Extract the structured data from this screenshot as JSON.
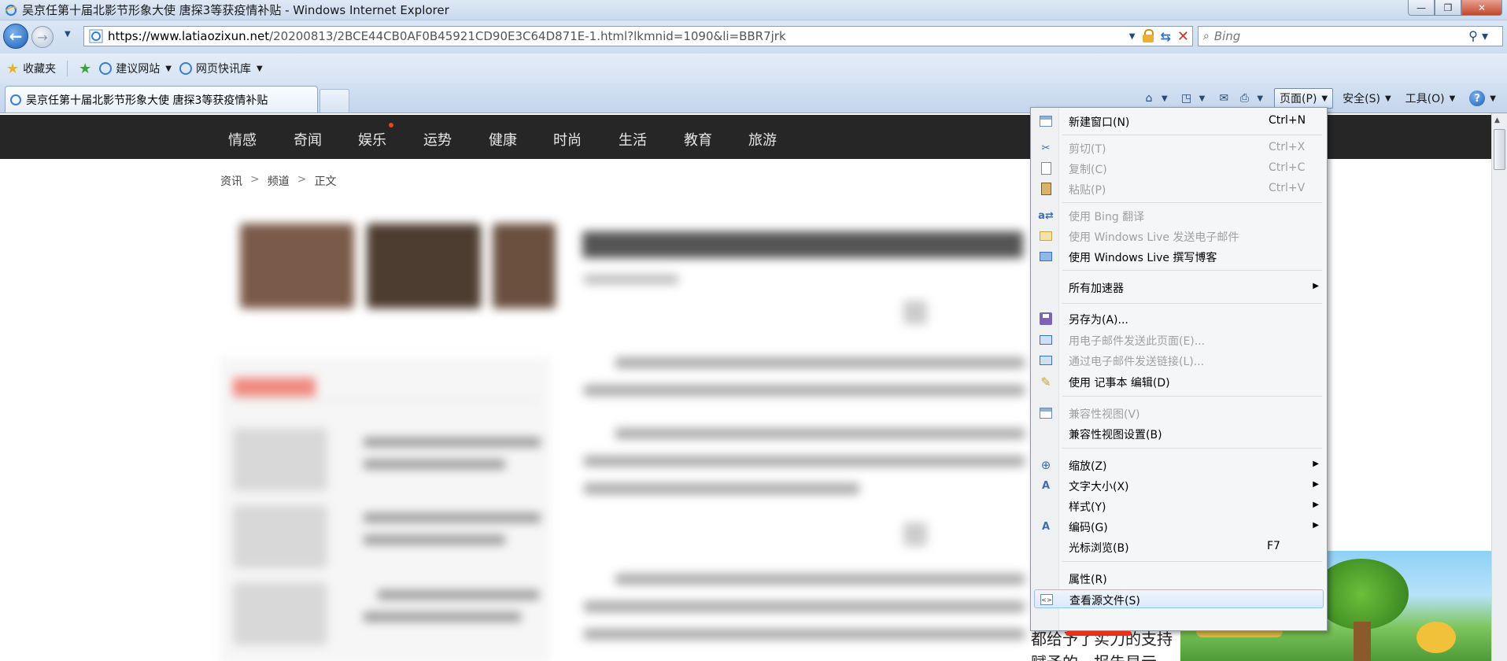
{
  "window": {
    "title": "吴京任第十届北影节形象大使 唐探3等获疫情补贴 - Windows Internet Explorer",
    "min_label": "—",
    "max_label": "❐",
    "close_label": "✕"
  },
  "address": {
    "url_scheme": "https://",
    "url_host": "www.latiaozixun.net",
    "url_rest": "/20200813/2BCE44CB0AF0B45921CD90E3C64D871E-1.html?lkmnid=1090&li=BBR7jrk",
    "search_placeholder": "Bing"
  },
  "favorites": {
    "label": "收藏夹",
    "items": [
      {
        "label": "建议网站"
      },
      {
        "label": "网页快讯库"
      }
    ]
  },
  "tab": {
    "label": "吴京任第十届北影节形象大使 唐探3等获疫情补贴"
  },
  "command_bar": {
    "page": "页面(P)",
    "safety": "安全(S)",
    "tools": "工具(O)",
    "help": "?"
  },
  "site": {
    "nav": [
      "情感",
      "奇闻",
      "娱乐",
      "运势",
      "健康",
      "时尚",
      "生活",
      "教育",
      "旅游"
    ],
    "breadcrumb": [
      "资讯",
      "频道",
      "正文"
    ],
    "breadcrumb_sep": ">",
    "article_fragment_1": "都给予了实力的支持",
    "article_fragment_2": "赋予的，报告显示"
  },
  "page_menu": {
    "items": [
      {
        "label": "新建窗口(N)",
        "shortcut": "Ctrl+N",
        "icon": "new-window-icon",
        "disabled": false
      },
      {
        "label": "剪切(T)",
        "shortcut": "Ctrl+X",
        "icon": "cut-icon",
        "disabled": true
      },
      {
        "label": "复制(C)",
        "shortcut": "Ctrl+C",
        "icon": "copy-icon",
        "disabled": true
      },
      {
        "label": "粘贴(P)",
        "shortcut": "Ctrl+V",
        "icon": "paste-icon",
        "disabled": false
      },
      {
        "label": "使用 Bing 翻译",
        "shortcut": "",
        "icon": "translate-icon",
        "disabled": true
      },
      {
        "label": "使用 Windows Live 发送电子邮件",
        "shortcut": "",
        "icon": "live-mail-icon",
        "disabled": true
      },
      {
        "label": "使用 Windows Live 撰写博客",
        "shortcut": "",
        "icon": "live-blog-icon",
        "disabled": false
      },
      {
        "label": "所有加速器",
        "shortcut": "",
        "icon": "",
        "disabled": false,
        "submenu": true
      },
      {
        "label": "另存为(A)...",
        "shortcut": "",
        "icon": "save-as-icon",
        "disabled": false
      },
      {
        "label": "用电子邮件发送此页面(E)...",
        "shortcut": "",
        "icon": "email-page-icon",
        "disabled": true
      },
      {
        "label": "通过电子邮件发送链接(L)...",
        "shortcut": "",
        "icon": "email-link-icon",
        "disabled": true
      },
      {
        "label": "使用 记事本 编辑(D)",
        "shortcut": "",
        "icon": "edit-pencil-icon",
        "disabled": false
      },
      {
        "label": "兼容性视图(V)",
        "shortcut": "",
        "icon": "compat-view-icon",
        "disabled": true
      },
      {
        "label": "兼容性视图设置(B)",
        "shortcut": "",
        "icon": "",
        "disabled": false
      },
      {
        "label": "缩放(Z)",
        "shortcut": "",
        "icon": "zoom-icon",
        "disabled": false,
        "submenu": true
      },
      {
        "label": "文字大小(X)",
        "shortcut": "",
        "icon": "text-size-icon",
        "disabled": false,
        "submenu": true
      },
      {
        "label": "样式(Y)",
        "shortcut": "",
        "icon": "",
        "disabled": false,
        "submenu": true
      },
      {
        "label": "编码(G)",
        "shortcut": "",
        "icon": "encoding-icon",
        "disabled": false,
        "submenu": true
      },
      {
        "label": "光标浏览(B)",
        "shortcut": "F7",
        "icon": "",
        "disabled": false
      },
      {
        "label": "属性(R)",
        "shortcut": "",
        "icon": "",
        "disabled": false
      },
      {
        "label": "查看源文件(S)",
        "shortcut": "",
        "icon": "view-source-icon",
        "disabled": false,
        "highlighted": true
      }
    ]
  },
  "colors": {
    "site_nav_bg": "#262626",
    "menu_highlight_border": "#9cc0ea",
    "annotation_red": "#e8301c"
  }
}
